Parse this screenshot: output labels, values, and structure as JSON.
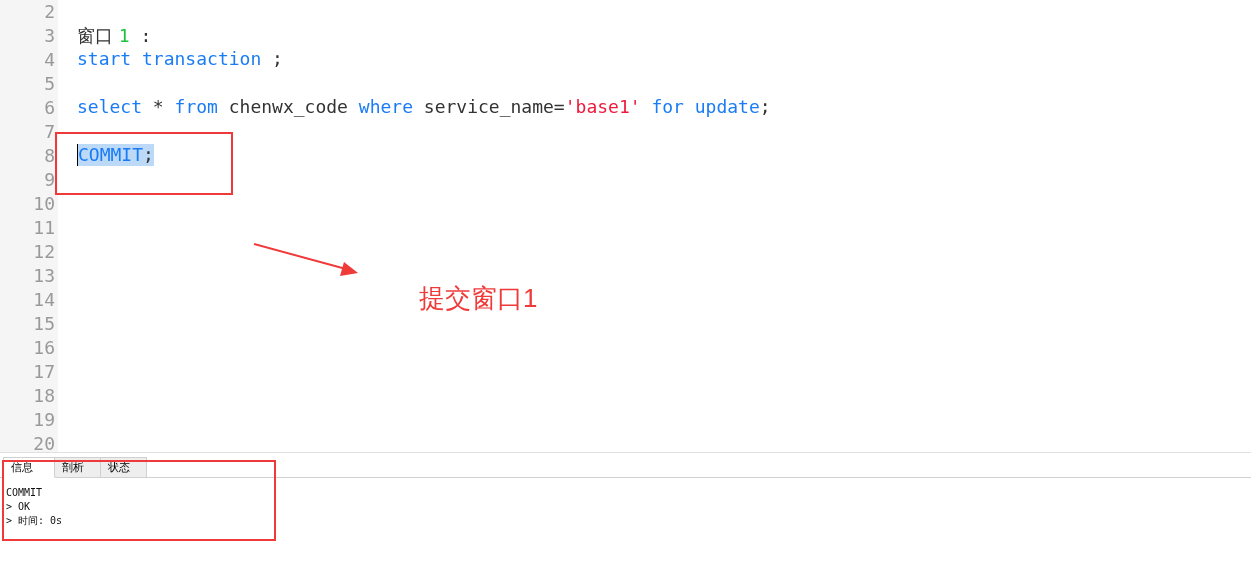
{
  "editor": {
    "lines": [
      {
        "number": "2",
        "selected": false
      },
      {
        "number": "3",
        "selected": false,
        "tokens": [
          {
            "kind": "cjk",
            "text": "窗口 "
          },
          {
            "kind": "number",
            "text": "1"
          },
          {
            "kind": "plain",
            "text": " :"
          }
        ]
      },
      {
        "number": "4",
        "selected": false,
        "tokens": [
          {
            "kind": "keyword",
            "text": "start transaction"
          },
          {
            "kind": "plain",
            "text": " ;"
          }
        ]
      },
      {
        "number": "5",
        "selected": false
      },
      {
        "number": "6",
        "selected": false,
        "tokens": [
          {
            "kind": "keyword",
            "text": "select"
          },
          {
            "kind": "plain",
            "text": " * "
          },
          {
            "kind": "keyword",
            "text": "from"
          },
          {
            "kind": "plain",
            "text": " chenwx_code "
          },
          {
            "kind": "keyword",
            "text": "where"
          },
          {
            "kind": "plain",
            "text": " service_name="
          },
          {
            "kind": "string",
            "text": "'base1'"
          },
          {
            "kind": "keyword",
            "text": " for update"
          },
          {
            "kind": "plain",
            "text": ";"
          }
        ]
      },
      {
        "number": "7",
        "selected": false
      },
      {
        "number": "8",
        "selected": true,
        "tokens": [
          {
            "kind": "keyword",
            "text": "COMMIT"
          },
          {
            "kind": "plain",
            "text": ";"
          }
        ]
      },
      {
        "number": "9",
        "selected": false
      },
      {
        "number": "10",
        "selected": false
      },
      {
        "number": "11",
        "selected": false
      },
      {
        "number": "12",
        "selected": false
      },
      {
        "number": "13",
        "selected": false
      },
      {
        "number": "14",
        "selected": false
      },
      {
        "number": "15",
        "selected": false
      },
      {
        "number": "16",
        "selected": false
      },
      {
        "number": "17",
        "selected": false
      },
      {
        "number": "18",
        "selected": false
      },
      {
        "number": "19",
        "selected": false
      },
      {
        "number": "20",
        "selected": false
      }
    ]
  },
  "annotation": {
    "text": "提交窗口1"
  },
  "result_panel": {
    "tabs": [
      {
        "label": "信息",
        "selected": true
      },
      {
        "label": "剖析",
        "selected": false
      },
      {
        "label": "状态",
        "selected": false
      }
    ],
    "messages": [
      "COMMIT",
      "> OK",
      "> 时间: 0s"
    ]
  }
}
